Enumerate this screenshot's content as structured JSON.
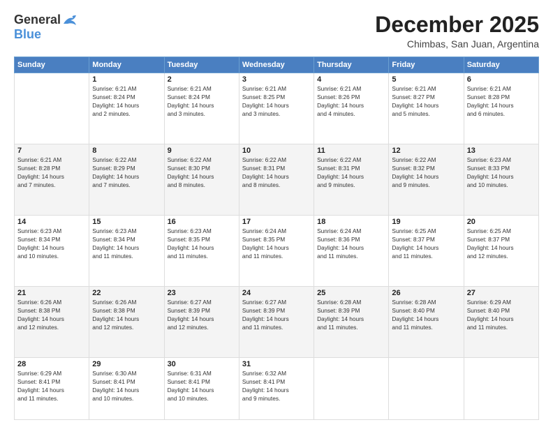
{
  "header": {
    "logo_general": "General",
    "logo_blue": "Blue",
    "month_title": "December 2025",
    "location": "Chimbas, San Juan, Argentina"
  },
  "calendar": {
    "days_of_week": [
      "Sunday",
      "Monday",
      "Tuesday",
      "Wednesday",
      "Thursday",
      "Friday",
      "Saturday"
    ],
    "weeks": [
      [
        {
          "day": "",
          "info": ""
        },
        {
          "day": "1",
          "info": "Sunrise: 6:21 AM\nSunset: 8:24 PM\nDaylight: 14 hours\nand 2 minutes."
        },
        {
          "day": "2",
          "info": "Sunrise: 6:21 AM\nSunset: 8:24 PM\nDaylight: 14 hours\nand 3 minutes."
        },
        {
          "day": "3",
          "info": "Sunrise: 6:21 AM\nSunset: 8:25 PM\nDaylight: 14 hours\nand 3 minutes."
        },
        {
          "day": "4",
          "info": "Sunrise: 6:21 AM\nSunset: 8:26 PM\nDaylight: 14 hours\nand 4 minutes."
        },
        {
          "day": "5",
          "info": "Sunrise: 6:21 AM\nSunset: 8:27 PM\nDaylight: 14 hours\nand 5 minutes."
        },
        {
          "day": "6",
          "info": "Sunrise: 6:21 AM\nSunset: 8:28 PM\nDaylight: 14 hours\nand 6 minutes."
        }
      ],
      [
        {
          "day": "7",
          "info": "Sunrise: 6:21 AM\nSunset: 8:28 PM\nDaylight: 14 hours\nand 7 minutes."
        },
        {
          "day": "8",
          "info": "Sunrise: 6:22 AM\nSunset: 8:29 PM\nDaylight: 14 hours\nand 7 minutes."
        },
        {
          "day": "9",
          "info": "Sunrise: 6:22 AM\nSunset: 8:30 PM\nDaylight: 14 hours\nand 8 minutes."
        },
        {
          "day": "10",
          "info": "Sunrise: 6:22 AM\nSunset: 8:31 PM\nDaylight: 14 hours\nand 8 minutes."
        },
        {
          "day": "11",
          "info": "Sunrise: 6:22 AM\nSunset: 8:31 PM\nDaylight: 14 hours\nand 9 minutes."
        },
        {
          "day": "12",
          "info": "Sunrise: 6:22 AM\nSunset: 8:32 PM\nDaylight: 14 hours\nand 9 minutes."
        },
        {
          "day": "13",
          "info": "Sunrise: 6:23 AM\nSunset: 8:33 PM\nDaylight: 14 hours\nand 10 minutes."
        }
      ],
      [
        {
          "day": "14",
          "info": "Sunrise: 6:23 AM\nSunset: 8:34 PM\nDaylight: 14 hours\nand 10 minutes."
        },
        {
          "day": "15",
          "info": "Sunrise: 6:23 AM\nSunset: 8:34 PM\nDaylight: 14 hours\nand 11 minutes."
        },
        {
          "day": "16",
          "info": "Sunrise: 6:23 AM\nSunset: 8:35 PM\nDaylight: 14 hours\nand 11 minutes."
        },
        {
          "day": "17",
          "info": "Sunrise: 6:24 AM\nSunset: 8:35 PM\nDaylight: 14 hours\nand 11 minutes."
        },
        {
          "day": "18",
          "info": "Sunrise: 6:24 AM\nSunset: 8:36 PM\nDaylight: 14 hours\nand 11 minutes."
        },
        {
          "day": "19",
          "info": "Sunrise: 6:25 AM\nSunset: 8:37 PM\nDaylight: 14 hours\nand 11 minutes."
        },
        {
          "day": "20",
          "info": "Sunrise: 6:25 AM\nSunset: 8:37 PM\nDaylight: 14 hours\nand 12 minutes."
        }
      ],
      [
        {
          "day": "21",
          "info": "Sunrise: 6:26 AM\nSunset: 8:38 PM\nDaylight: 14 hours\nand 12 minutes."
        },
        {
          "day": "22",
          "info": "Sunrise: 6:26 AM\nSunset: 8:38 PM\nDaylight: 14 hours\nand 12 minutes."
        },
        {
          "day": "23",
          "info": "Sunrise: 6:27 AM\nSunset: 8:39 PM\nDaylight: 14 hours\nand 12 minutes."
        },
        {
          "day": "24",
          "info": "Sunrise: 6:27 AM\nSunset: 8:39 PM\nDaylight: 14 hours\nand 11 minutes."
        },
        {
          "day": "25",
          "info": "Sunrise: 6:28 AM\nSunset: 8:39 PM\nDaylight: 14 hours\nand 11 minutes."
        },
        {
          "day": "26",
          "info": "Sunrise: 6:28 AM\nSunset: 8:40 PM\nDaylight: 14 hours\nand 11 minutes."
        },
        {
          "day": "27",
          "info": "Sunrise: 6:29 AM\nSunset: 8:40 PM\nDaylight: 14 hours\nand 11 minutes."
        }
      ],
      [
        {
          "day": "28",
          "info": "Sunrise: 6:29 AM\nSunset: 8:41 PM\nDaylight: 14 hours\nand 11 minutes."
        },
        {
          "day": "29",
          "info": "Sunrise: 6:30 AM\nSunset: 8:41 PM\nDaylight: 14 hours\nand 10 minutes."
        },
        {
          "day": "30",
          "info": "Sunrise: 6:31 AM\nSunset: 8:41 PM\nDaylight: 14 hours\nand 10 minutes."
        },
        {
          "day": "31",
          "info": "Sunrise: 6:32 AM\nSunset: 8:41 PM\nDaylight: 14 hours\nand 9 minutes."
        },
        {
          "day": "",
          "info": ""
        },
        {
          "day": "",
          "info": ""
        },
        {
          "day": "",
          "info": ""
        }
      ]
    ]
  }
}
